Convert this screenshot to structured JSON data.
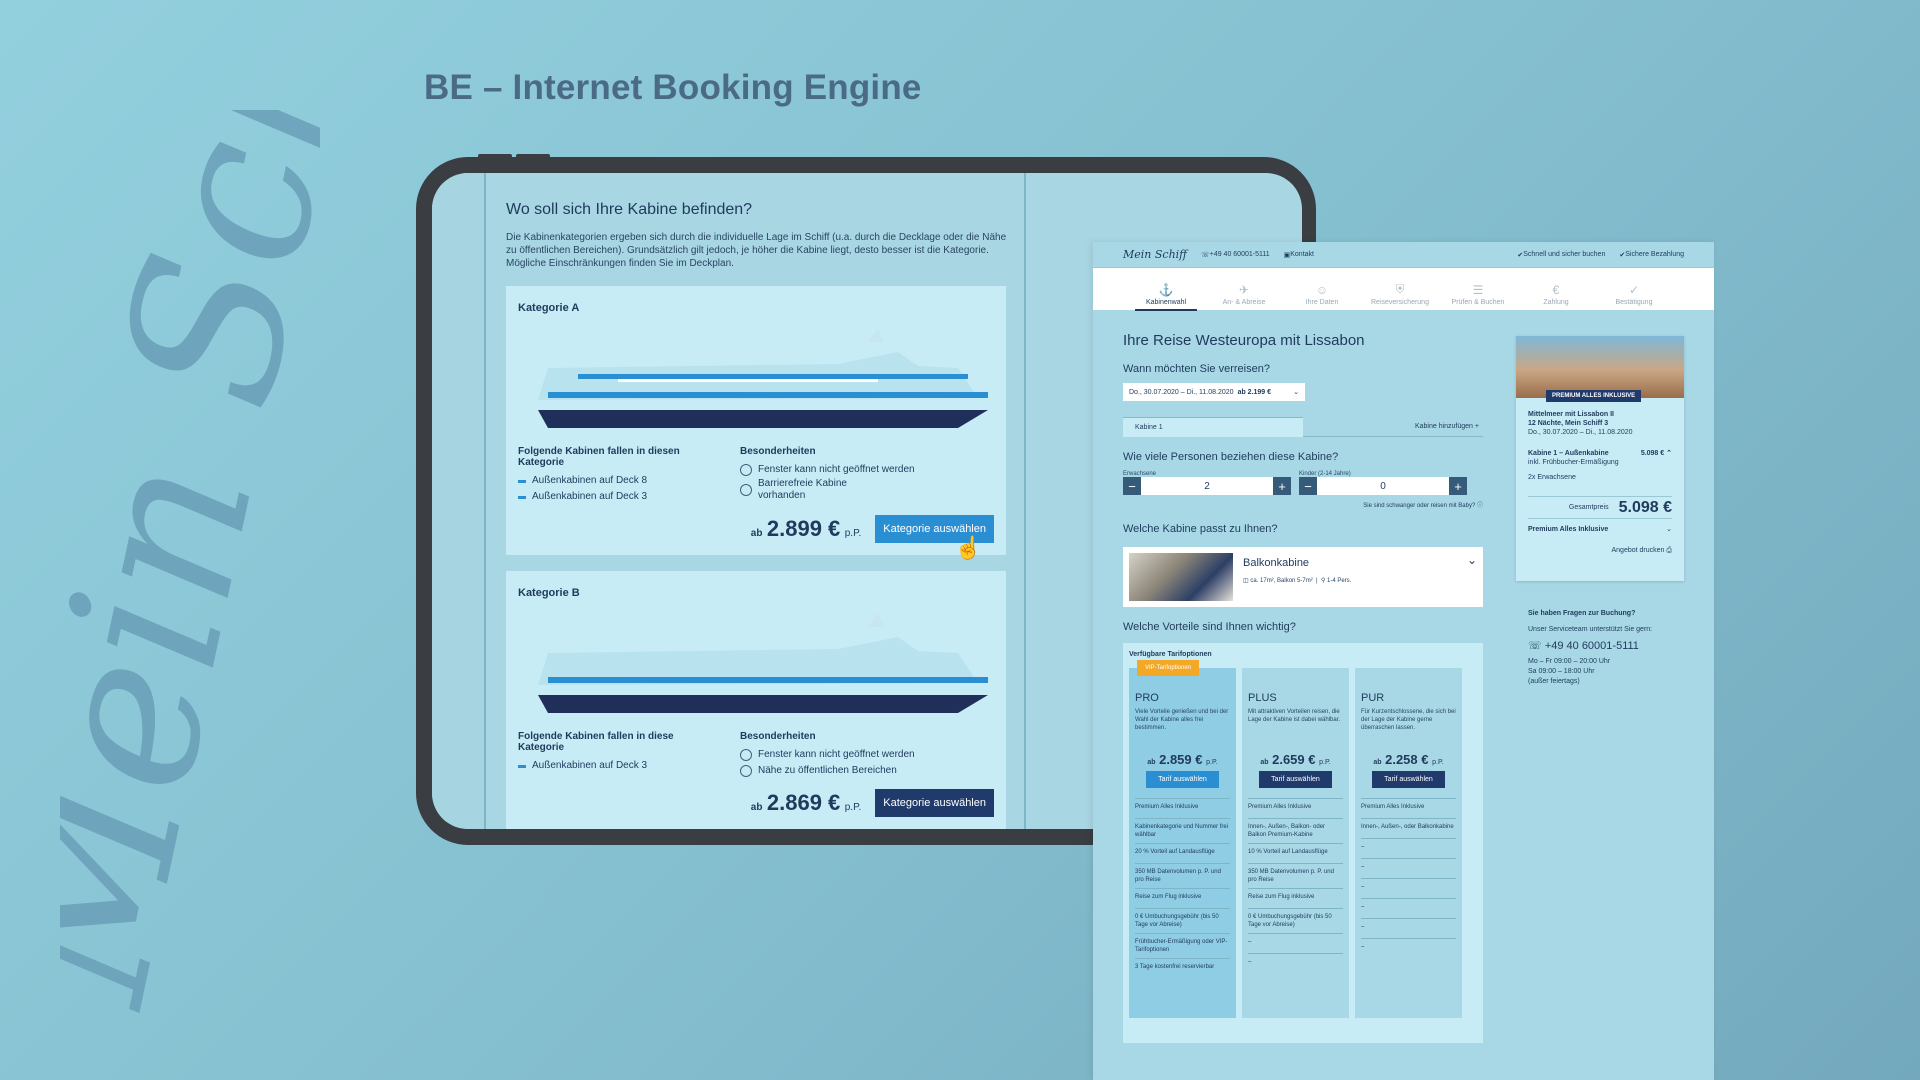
{
  "slide": {
    "title": "BE – Internet Booking Engine",
    "signature": "Mein Schiff"
  },
  "tablet": {
    "heading": "Wo soll sich Ihre Kabine befinden?",
    "intro": "Die Kabinenkategorien ergeben sich durch die individuelle Lage im Schiff (u.a. durch die Decklage oder die Nähe zu öffentlichen Bereichen). Grundsätzlich gilt jedoch, je höher die Kabine liegt, desto besser ist die Kategorie. Mögliche Einschränkungen finden Sie im Deckplan.",
    "cat_a": {
      "title": "Kategorie A",
      "list_heading": "Folgende Kabinen fallen in diesen Kategorie",
      "cabins": [
        "Außenkabinen auf Deck 8",
        "Außenkabinen auf Deck 3"
      ],
      "special_heading": "Besonderheiten",
      "specials": [
        "Fenster kann nicht geöffnet werden",
        "Barrierefreie Kabine vorhanden"
      ],
      "ab": "ab",
      "price": "2.899 €",
      "pp": "p.P.",
      "button": "Kategorie auswählen"
    },
    "cat_b": {
      "title": "Kategorie B",
      "list_heading": "Folgende Kabinen fallen in diese Kategorie",
      "cabins": [
        "Außenkabinen auf Deck 3"
      ],
      "special_heading": "Besonderheiten",
      "specials": [
        "Fenster kann nicht geöffnet werden",
        "Nähe zu öffentlichen Bereichen"
      ],
      "ab": "ab",
      "price": "2.869 €",
      "pp": "p.P.",
      "button": "Kategorie auswählen"
    }
  },
  "web": {
    "logo": "Mein Schiff",
    "phone": "+49 40 60001-5111",
    "contact": "Kontakt",
    "trust1": "Schnell und sicher buchen",
    "trust2": "Sichere Bezahlung",
    "steps": [
      "Kabinenwahl",
      "An- & Abreise",
      "Ihre Daten",
      "Reiseversicherung",
      "Prüfen & Buchen",
      "Zahlung",
      "Bestätigung"
    ],
    "trip_title": "Ihre Reise Westeuropa mit Lissabon",
    "when": "Wann möchten Sie verreisen?",
    "date_value": "Do., 30.07.2020 – Di., 11.08.2020",
    "date_price": "ab 2.199 €",
    "cabin_tab": "Kabine 1",
    "add_cabin": "Kabine hinzufügen",
    "persons_q": "Wie viele Personen beziehen diese Kabine?",
    "adults_label": "Erwachsene",
    "adults": "2",
    "kids_label": "Kinder (2-14 Jahre)",
    "kids": "0",
    "baby_hint": "Sie sind schwanger oder reisen mit Baby?",
    "cabin_q": "Welche Kabine passt zu Ihnen?",
    "cabin_name": "Balkonkabine",
    "cabin_size": "ca. 17m², Balkon 5-7m²",
    "cabin_pers": "1-4 Pers.",
    "benefits_q": "Welche Vorteile sind Ihnen wichtig?",
    "tarif_heading": "Verfügbare Tarifoptionen",
    "vip": "VIP-Tarifoptionen",
    "tarifs": [
      {
        "name": "PRO",
        "desc": "Viele Vorteile genießen und bei der Wahl der Kabine alles frei bestimmen.",
        "ab": "ab",
        "price": "2.859 €",
        "pp": "p.P.",
        "button": "Tarif auswählen"
      },
      {
        "name": "PLUS",
        "desc": "Mit attraktiven Vorteilen reisen, die Lage der Kabine ist dabei wählbar.",
        "ab": "ab",
        "price": "2.659 €",
        "pp": "p.P.",
        "button": "Tarif auswählen"
      },
      {
        "name": "PUR",
        "desc": "Für Kurzentschlossene, die sich bei der Lage der Kabine gerne überraschen lassen.",
        "ab": "ab",
        "price": "2.258 €",
        "pp": "p.P.",
        "button": "Tarif auswählen"
      }
    ],
    "features": [
      [
        "Premium Alles Inklusive",
        "Premium Alles Inklusive",
        "Premium Alles Inklusive"
      ],
      [
        "Kabinenkategorie und Nummer frei wählbar",
        "Innen-, Außen-, Balkon- oder Balkon Premium-Kabine",
        "Innen-, Außen-, oder Balkonkabine"
      ],
      [
        "20 % Vorteil auf Landausflüge",
        "10 % Vorteil auf Landausflüge",
        "–"
      ],
      [
        "350 MB Datenvolumen p. P. und pro Reise",
        "350 MB Datenvolumen p. P. und pro Reise",
        "–"
      ],
      [
        "Reise zum Flug inklusive",
        "Reise zum Flug inklusive",
        "–"
      ],
      [
        "0 € Umbuchungsgebühr (bis 50 Tage vor Abreise)",
        "0 € Umbuchungsgebühr (bis 50 Tage vor Abreise)",
        "–"
      ],
      [
        "Frühbucher-Ermäßigung oder VIP-Tarifoptionen",
        "–",
        "–"
      ],
      [
        "3 Tage kostenfrei reservierbar",
        "–",
        "–"
      ]
    ],
    "summary": {
      "badge": "PREMIUM ALLES INKLUSIVE",
      "route": "Mittelmeer mit Lissabon II",
      "nights": "12 Nächte, Mein Schiff 3",
      "dates": "Do., 30.07.2020 – Di., 11.08.2020",
      "cabin": "Kabine 1 – Außenkabine",
      "cabin_sub": "inkl. Frühbucher-Ermäßigung",
      "cabin_price": "5.098 €",
      "pax": "2x Erwachsene",
      "total_label": "Gesamtpreis",
      "total": "5.098 €",
      "tarif": "Premium Alles Inklusive",
      "print": "Angebot drucken"
    },
    "help": {
      "title": "Sie haben Fragen zur Buchung?",
      "sub": "Unser Serviceteam unterstützt Sie gern:",
      "phone": "+49 40 60001-5111",
      "hours1": "Mo – Fr 09:00 – 20:00 Uhr",
      "hours2": "Sa 09:00 – 18:00 Uhr",
      "hours3": "(außer feiertags)"
    }
  }
}
